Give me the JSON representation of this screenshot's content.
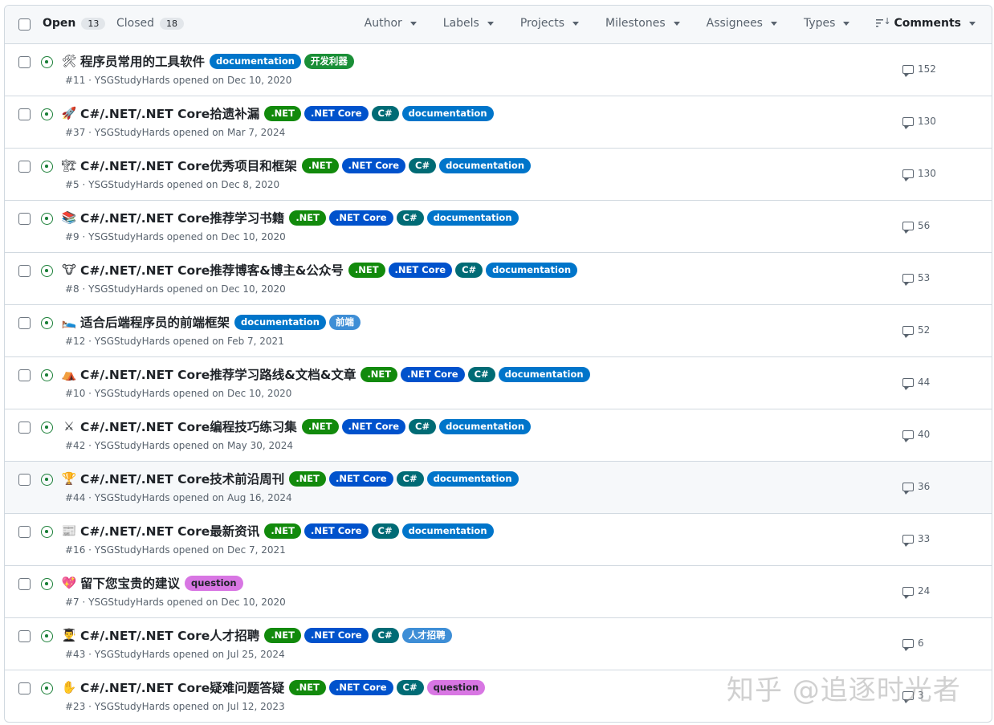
{
  "header": {
    "open_label": "Open",
    "open_count": "13",
    "closed_label": "Closed",
    "closed_count": "18",
    "filters": [
      "Author",
      "Labels",
      "Projects",
      "Milestones",
      "Assignees",
      "Types"
    ],
    "sort_label": "Comments"
  },
  "label_colors": {
    "documentation": "#0075ca",
    ".NET": "#128a0c",
    ".NET Core": "#0052cc",
    "C#": "#006b75",
    "开发利器": "#1a8f37",
    "前端": "#3e8ed6",
    "question": "#d876e3",
    "人才招聘": "#3e8ed6"
  },
  "issues": [
    {
      "emoji": "🛠",
      "title": "程序员常用的工具软件",
      "labels": [
        "documentation",
        "开发利器"
      ],
      "meta": "#11 · YSGStudyHards opened on Dec 10, 2020",
      "comments": "152"
    },
    {
      "emoji": "🚀",
      "title": "C#/.NET/.NET Core拾遗补漏",
      "labels": [
        ".NET",
        ".NET Core",
        "C#",
        "documentation"
      ],
      "meta": "#37 · YSGStudyHards opened on Mar 7, 2024",
      "comments": "130"
    },
    {
      "emoji": "🏗",
      "title": "C#/.NET/.NET Core优秀项目和框架",
      "labels": [
        ".NET",
        ".NET Core",
        "C#",
        "documentation"
      ],
      "meta": "#5 · YSGStudyHards opened on Dec 8, 2020",
      "comments": "130"
    },
    {
      "emoji": "📚",
      "title": "C#/.NET/.NET Core推荐学习书籍",
      "labels": [
        ".NET",
        ".NET Core",
        "C#",
        "documentation"
      ],
      "meta": "#9 · YSGStudyHards opened on Dec 10, 2020",
      "comments": "56"
    },
    {
      "emoji": "🐮",
      "title": "C#/.NET/.NET Core推荐博客&博主&公众号",
      "labels": [
        ".NET",
        ".NET Core",
        "C#",
        "documentation"
      ],
      "meta": "#8 · YSGStudyHards opened on Dec 10, 2020",
      "comments": "53"
    },
    {
      "emoji": "🛌",
      "title": "适合后端程序员的前端框架",
      "labels": [
        "documentation",
        "前端"
      ],
      "meta": "#12 · YSGStudyHards opened on Feb 7, 2021",
      "comments": "52"
    },
    {
      "emoji": "⛺",
      "title": "C#/.NET/.NET Core推荐学习路线&文档&文章",
      "labels": [
        ".NET",
        ".NET Core",
        "C#",
        "documentation"
      ],
      "meta": "#10 · YSGStudyHards opened on Dec 10, 2020",
      "comments": "44"
    },
    {
      "emoji": "⚔",
      "title": "C#/.NET/.NET Core编程技巧练习集",
      "labels": [
        ".NET",
        ".NET Core",
        "C#",
        "documentation"
      ],
      "meta": "#42 · YSGStudyHards opened on May 30, 2024",
      "comments": "40"
    },
    {
      "emoji": "🏆",
      "title": "C#/.NET/.NET Core技术前沿周刊",
      "labels": [
        ".NET",
        ".NET Core",
        "C#",
        "documentation"
      ],
      "meta": "#44 · YSGStudyHards opened on Aug 16, 2024",
      "comments": "36"
    },
    {
      "emoji": "📰",
      "title": "C#/.NET/.NET Core最新资讯",
      "labels": [
        ".NET",
        ".NET Core",
        "C#",
        "documentation"
      ],
      "meta": "#16 · YSGStudyHards opened on Dec 7, 2021",
      "comments": "33"
    },
    {
      "emoji": "💖",
      "title": "留下您宝贵的建议",
      "labels": [
        "question"
      ],
      "meta": "#7 · YSGStudyHards opened on Dec 10, 2020",
      "comments": "24"
    },
    {
      "emoji": "👨‍🎓",
      "title": "C#/.NET/.NET Core人才招聘",
      "labels": [
        ".NET",
        ".NET Core",
        "C#",
        "人才招聘"
      ],
      "meta": "#43 · YSGStudyHards opened on Jul 25, 2024",
      "comments": "6"
    },
    {
      "emoji": "✋",
      "title": "C#/.NET/.NET Core疑难问题答疑",
      "labels": [
        ".NET",
        ".NET Core",
        "C#",
        "question"
      ],
      "meta": "#23 · YSGStudyHards opened on Jul 12, 2023",
      "comments": "3"
    }
  ],
  "watermark": "知乎 @追逐时光者"
}
